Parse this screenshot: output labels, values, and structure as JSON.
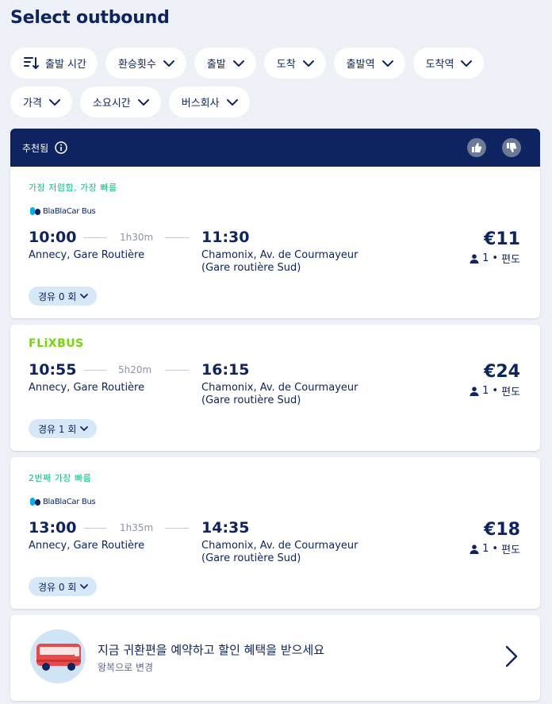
{
  "page": {
    "title": "Select outbound"
  },
  "filters": {
    "row1": [
      "출발 시간",
      "환승횟수",
      "출발",
      "도착",
      "출발역",
      "도착역"
    ],
    "row2": [
      "가격",
      "소요시간",
      "버스회사"
    ]
  },
  "recommended": {
    "label": "추천됨"
  },
  "trips": [
    {
      "tag": "가장 저렴함,  가장 빠름",
      "operator": "BlaBlaCar Bus",
      "dep_time": "10:00",
      "duration": "1h30m",
      "arr_time": "11:30",
      "dep_station": "Annecy, Gare Routière",
      "arr_station": "Chamonix, Av. de Courmayeur (Gare routière Sud)",
      "price": "€11",
      "passengers": "1",
      "trip_type": "편도",
      "stops": "경유 0 회"
    },
    {
      "tag": "",
      "operator": "FLiXBUS",
      "dep_time": "10:55",
      "duration": "5h20m",
      "arr_time": "16:15",
      "dep_station": "Annecy, Gare Routière",
      "arr_station": "Chamonix, Av. de Courmayeur (Gare routière Sud)",
      "price": "€24",
      "passengers": "1",
      "trip_type": "편도",
      "stops": "경유 1 회"
    },
    {
      "tag": "2번째 가장 빠름",
      "operator": "BlaBlaCar Bus",
      "dep_time": "13:00",
      "duration": "1h35m",
      "arr_time": "14:35",
      "dep_station": "Annecy, Gare Routière",
      "arr_station": "Chamonix, Av. de Courmayeur (Gare routière Sud)",
      "price": "€18",
      "passengers": "1",
      "trip_type": "편도",
      "stops": "경유 0 회"
    }
  ],
  "promo": {
    "title": "지금 귀환편을 예약하고 할인 혜택을 받으세요",
    "subtitle": "왕복으로 변경"
  },
  "colors": {
    "primary": "#0d2460",
    "tag_green": "#14b87a",
    "flix_green": "#73d700",
    "stops_bg": "#d6e8f7",
    "background": "#edf1f7"
  }
}
